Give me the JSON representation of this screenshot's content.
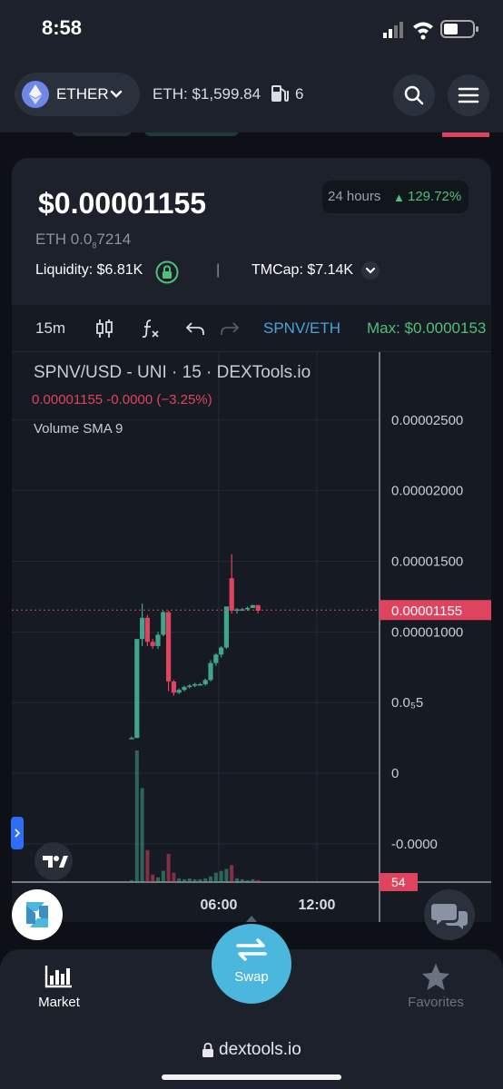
{
  "status": {
    "time": "8:58"
  },
  "nav": {
    "chain": "ETHER",
    "eth_price": "ETH: $1,599.84",
    "gas": "6"
  },
  "token": {
    "price_usd": "$0.00001155",
    "price_eth_prefix": "ETH 0.0",
    "price_eth_sub": "8",
    "price_eth_suffix": "7214",
    "change_period": "24 hours",
    "change_value": "129.72%",
    "liquidity": "Liquidity: $6.81K",
    "separator": "|",
    "tmcap": "TMCap: $7.14K"
  },
  "toolbar": {
    "timeframe": "15m",
    "pair": "SPNV/ETH",
    "max": "Max: $0.0000153"
  },
  "chart_legend": {
    "title": "SPNV/USD - UNI · 15 · DEXTools.io",
    "values": "0.00001155  -0.0000 (−3.25%)",
    "volume": "Volume SMA 9"
  },
  "chart_data": {
    "type": "candlestick",
    "title": "SPNV/USD - UNI · 15 · DEXTools.io",
    "y_ticks": [
      "0.00002500",
      "0.00002000",
      "0.00001500",
      "0.00001000",
      "0.0₅5",
      "0",
      "-0.0000"
    ],
    "y_tick_values": [
      2.5e-05,
      2e-05,
      1.5e-05,
      1e-05,
      5e-06,
      0,
      -5e-06
    ],
    "x_ticks": [
      "06:00",
      "12:00"
    ],
    "current_price_label": "0.00001155",
    "current_price": 1.155e-05,
    "volume_label": "54",
    "ylim": [
      -7.7e-06,
      2.98e-05
    ],
    "candles": [
      {
        "o": 2.5e-06,
        "h": 2.6e-06,
        "l": 2.5e-06,
        "c": 2.5e-06
      },
      {
        "o": 2.5e-06,
        "h": 9.5e-06,
        "l": 2.5e-06,
        "c": 9.5e-06
      },
      {
        "o": 9.5e-06,
        "h": 1.2e-05,
        "l": 9e-06,
        "c": 1.1e-05
      },
      {
        "o": 1.1e-05,
        "h": 1.12e-05,
        "l": 9e-06,
        "c": 9.3e-06
      },
      {
        "o": 9.3e-06,
        "h": 9.5e-06,
        "l": 8.8e-06,
        "c": 9e-06
      },
      {
        "o": 9e-06,
        "h": 1e-05,
        "l": 8.8e-06,
        "c": 9.8e-06
      },
      {
        "o": 9.8e-06,
        "h": 1.15e-05,
        "l": 9.7e-06,
        "c": 1.14e-05
      },
      {
        "o": 1.14e-05,
        "h": 1.15e-05,
        "l": 5.8e-06,
        "c": 6.5e-06
      },
      {
        "o": 6.5e-06,
        "h": 6.6e-06,
        "l": 5.5e-06,
        "c": 5.7e-06
      },
      {
        "o": 5.7e-06,
        "h": 6e-06,
        "l": 5.6e-06,
        "c": 5.9e-06
      },
      {
        "o": 5.9e-06,
        "h": 6.2e-06,
        "l": 5.8e-06,
        "c": 6.1e-06
      },
      {
        "o": 6.1e-06,
        "h": 6.3e-06,
        "l": 6e-06,
        "c": 6.2e-06
      },
      {
        "o": 6.2e-06,
        "h": 6.4e-06,
        "l": 6.1e-06,
        "c": 6.3e-06
      },
      {
        "o": 6.3e-06,
        "h": 6.4e-06,
        "l": 6.2e-06,
        "c": 6.3e-06
      },
      {
        "o": 6.3e-06,
        "h": 6.7e-06,
        "l": 6.2e-06,
        "c": 6.6e-06
      },
      {
        "o": 6.6e-06,
        "h": 8e-06,
        "l": 6.5e-06,
        "c": 7.8e-06
      },
      {
        "o": 7.8e-06,
        "h": 8.5e-06,
        "l": 7.6e-06,
        "c": 8.4e-06
      },
      {
        "o": 8.4e-06,
        "h": 9e-06,
        "l": 8.2e-06,
        "c": 8.9e-06
      },
      {
        "o": 8.9e-06,
        "h": 1.18e-05,
        "l": 8.8e-06,
        "c": 1.18e-05
      },
      {
        "o": 1.38e-05,
        "h": 1.55e-05,
        "l": 1.13e-05,
        "c": 1.15e-05
      },
      {
        "o": 1.15e-05,
        "h": 1.17e-05,
        "l": 1.13e-05,
        "c": 1.16e-05
      },
      {
        "o": 1.16e-05,
        "h": 1.17e-05,
        "l": 1.15e-05,
        "c": 1.16e-05
      },
      {
        "o": 1.16e-05,
        "h": 1.18e-05,
        "l": 1.15e-05,
        "c": 1.17e-05
      },
      {
        "o": 1.17e-05,
        "h": 1.19e-05,
        "l": 1.17e-05,
        "c": 1.19e-05
      },
      {
        "o": 1.19e-05,
        "h": 1.19e-05,
        "l": 1.13e-05,
        "c": 1.15e-05
      }
    ],
    "volumes": [
      2,
      140,
      100,
      34,
      8,
      5,
      12,
      30,
      10,
      4,
      3,
      4,
      3,
      3,
      4,
      6,
      10,
      12,
      14,
      18,
      4,
      3,
      2,
      3,
      2
    ]
  },
  "bottom_nav": {
    "market": "Market",
    "swap": "Swap",
    "favorites": "Favorites"
  },
  "url": {
    "domain": "dextools.io"
  },
  "colors": {
    "up": "#3fa58b",
    "down": "#e0435e",
    "accent": "#4bb7dc"
  }
}
